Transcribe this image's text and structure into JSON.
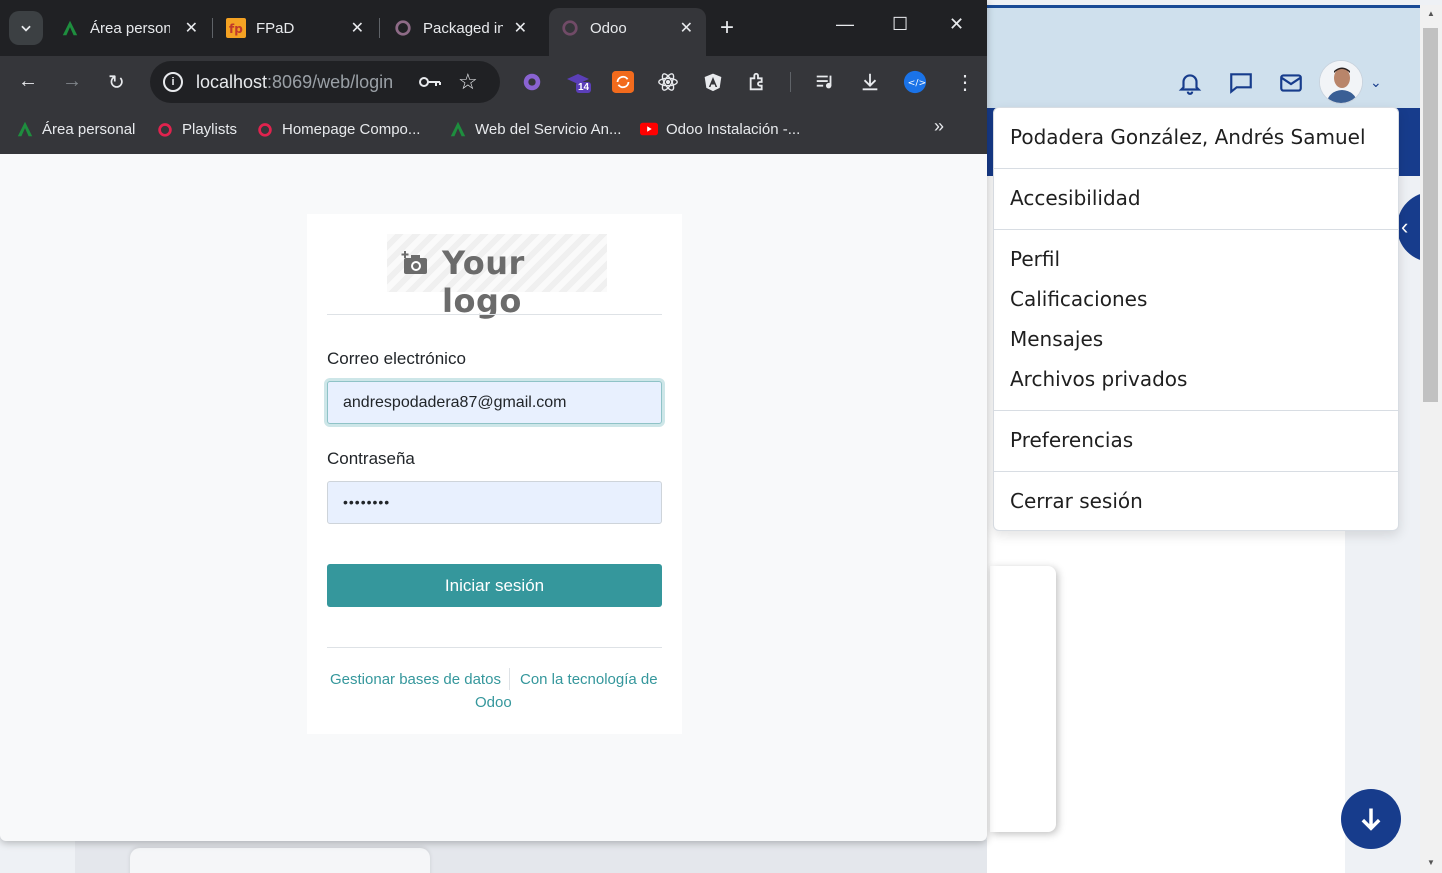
{
  "browser": {
    "tabs": [
      {
        "label": "Área personal",
        "favicon": "moodle-a-icon"
      },
      {
        "label": "FPaD",
        "favicon": "fpad-icon"
      },
      {
        "label": "Packaged inst",
        "favicon": "odoo-circle-icon"
      },
      {
        "label": "Odoo",
        "favicon": "odoo-circle-icon",
        "active": true
      }
    ],
    "url_host": "localhost",
    "url_path": ":8069/web/login",
    "extension_badge": "14",
    "bookmarks": [
      {
        "label": "Área personal",
        "favicon": "moodle-a-icon"
      },
      {
        "label": "Playlists",
        "favicon": "red-circle-icon"
      },
      {
        "label": "Homepage Compo...",
        "favicon": "red-circle-icon"
      },
      {
        "label": "Web del Servicio An...",
        "favicon": "moodle-a-icon"
      },
      {
        "label": "Odoo Instalación -...",
        "favicon": "youtube-icon"
      }
    ]
  },
  "login": {
    "logo_text": "Your logo",
    "email_label": "Correo electrónico",
    "email_value": "andrespodadera87@gmail.com",
    "password_label": "Contraseña",
    "password_value": "••••••••",
    "submit_label": "Iniciar sesión",
    "footer_manage": "Gestionar bases de datos",
    "footer_powered_1": "Con la tecnología de",
    "footer_powered_2": "Odoo"
  },
  "user_menu": {
    "user_name": "Podadera González, Andrés Samuel",
    "items": [
      "Accesibilidad",
      "Perfil",
      "Calificaciones",
      "Mensajes",
      "Archivos privados",
      "Preferencias",
      "Cerrar sesión"
    ]
  },
  "colors": {
    "odoo_teal": "#35979c",
    "site_blue": "#173c8c",
    "chrome_dark": "#35363a"
  }
}
